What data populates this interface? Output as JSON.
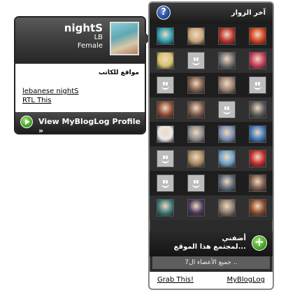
{
  "profile": {
    "name": "nightS",
    "country": "LB",
    "gender": "Female",
    "sites_heading": "مواقع للكاتب",
    "sites": [
      "lebanese nightS",
      "RTL This"
    ],
    "view_profile_label": "View MyBlogLog Profile »"
  },
  "widget": {
    "title": "آخر الزوار",
    "help_icon": "?",
    "join_icon": "+",
    "join_text": "أضفني\nلمجتمع هذا الموقع...",
    "all_members": "جميع الأعضاء ال7 ..",
    "grab_this": "Grab This!",
    "myBlogLog": "MyBlogLog"
  },
  "avatars": [
    {
      "kind": "photo",
      "color": "#2a9fb1"
    },
    {
      "kind": "photo",
      "color": "#c9a77a"
    },
    {
      "kind": "photo",
      "color": "#b4322c"
    },
    {
      "kind": "photo",
      "color": "#d2411e"
    },
    {
      "kind": "photo",
      "color": "#d8c36a"
    },
    {
      "kind": "default",
      "color": "#bcbcbc"
    },
    {
      "kind": "photo",
      "color": "#6e6e6e"
    },
    {
      "kind": "photo",
      "color": "#c83a5a"
    },
    {
      "kind": "default",
      "color": "#bcbcbc"
    },
    {
      "kind": "photo",
      "color": "#7a5b48"
    },
    {
      "kind": "photo",
      "color": "#9a8070"
    },
    {
      "kind": "default",
      "color": "#bcbcbc"
    },
    {
      "kind": "photo",
      "color": "#8f4a36"
    },
    {
      "kind": "photo",
      "color": "#7b5a4a"
    },
    {
      "kind": "default",
      "color": "#bcbcbc"
    },
    {
      "kind": "photo",
      "color": "#5a5a5a"
    },
    {
      "kind": "photo",
      "color": "#e8e8e8"
    },
    {
      "kind": "photo",
      "color": "#8c8c8c"
    },
    {
      "kind": "photo",
      "color": "#7a8fb2"
    },
    {
      "kind": "photo",
      "color": "#3e78b8"
    },
    {
      "kind": "default",
      "color": "#bcbcbc"
    },
    {
      "kind": "photo",
      "color": "#a88a62"
    },
    {
      "kind": "photo",
      "color": "#6da2c8"
    },
    {
      "kind": "photo",
      "color": "#c22a2a"
    },
    {
      "kind": "default",
      "color": "#bcbcbc"
    },
    {
      "kind": "default",
      "color": "#bcbcbc"
    },
    {
      "kind": "photo",
      "color": "#5a6a7a"
    },
    {
      "kind": "photo",
      "color": "#7a5a4a"
    },
    {
      "kind": "photo",
      "color": "#3e7a7a"
    },
    {
      "kind": "photo",
      "color": "#4a3a5a"
    },
    {
      "kind": "photo",
      "color": "#8a7a6a"
    },
    {
      "kind": "photo",
      "color": "#8a4a2a"
    }
  ]
}
